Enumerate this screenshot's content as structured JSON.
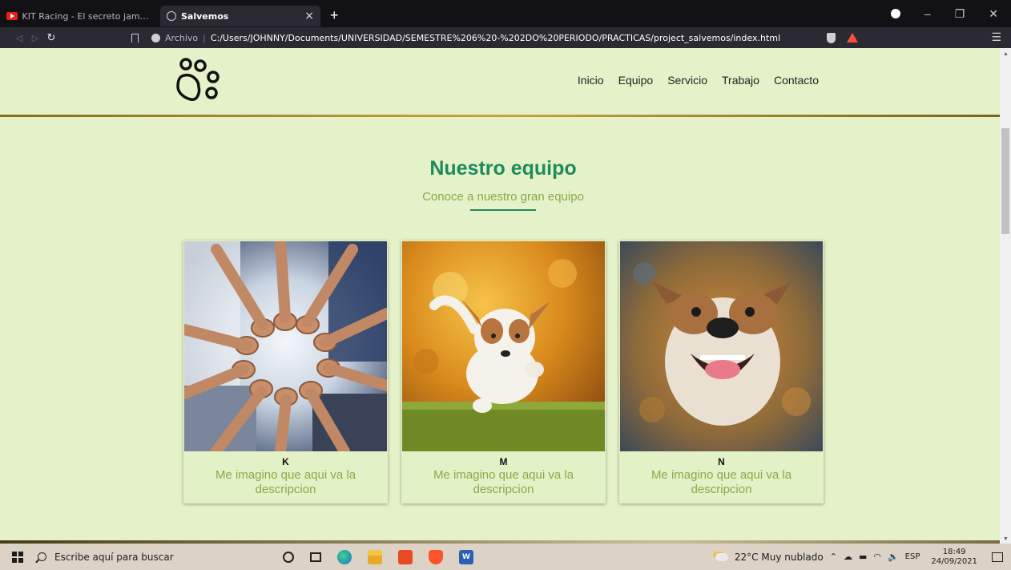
{
  "browser": {
    "tabs": [
      {
        "title": "KIT Racing - El secreto jamas contado",
        "icon": "youtube-icon",
        "active": false
      },
      {
        "title": "Salvemos",
        "icon": "globe-icon",
        "active": true
      }
    ],
    "new_tab_label": "+",
    "close_label": "×",
    "address": {
      "security_label": "Archivo",
      "url": "C:/Users/JOHNNY/Documents/UNIVERSIDAD/SEMESTRE%206%20-%202DO%20PERIODO/PRACTICAS/project_salvemos/index.html"
    },
    "window_controls": {
      "minimize": "–",
      "maximize": "❐",
      "close": "✕"
    },
    "menu": "☰"
  },
  "site": {
    "nav": [
      "Inicio",
      "Equipo",
      "Servicio",
      "Trabajo",
      "Contacto"
    ],
    "section": {
      "title": "Nuestro equipo",
      "subtitle": "Conoce a nuestro gran equipo"
    },
    "cards": [
      {
        "name": "K",
        "description": "Me imagino que aqui va la descripcion",
        "image": "team-hands-photo"
      },
      {
        "name": "M",
        "description": "Me imagino que aqui va la descripcion",
        "image": "jack-russell-puppy-photo"
      },
      {
        "name": "N",
        "description": "Me imagino que aqui va la descripcion",
        "image": "bulldog-photo"
      }
    ],
    "colors": {
      "background": "#e5f2c9",
      "title": "#1f8a5b",
      "accent": "#8aaa48",
      "divider": "#c7a43c"
    }
  },
  "taskbar": {
    "search_placeholder": "Escribe aquí para buscar",
    "weather": "22°C  Muy nublado",
    "language": "ESP",
    "time": "18:49",
    "date": "24/09/2021"
  }
}
